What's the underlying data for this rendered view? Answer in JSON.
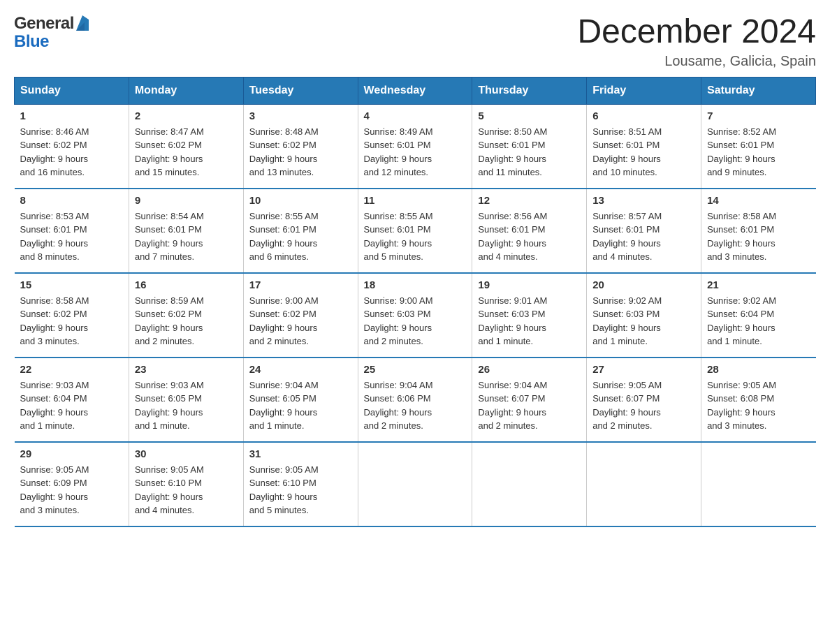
{
  "header": {
    "logo_general": "General",
    "logo_blue": "Blue",
    "month_title": "December 2024",
    "location": "Lousame, Galicia, Spain"
  },
  "days_of_week": [
    "Sunday",
    "Monday",
    "Tuesday",
    "Wednesday",
    "Thursday",
    "Friday",
    "Saturday"
  ],
  "weeks": [
    [
      {
        "day": "1",
        "sunrise": "8:46 AM",
        "sunset": "6:02 PM",
        "daylight": "9 hours and 16 minutes."
      },
      {
        "day": "2",
        "sunrise": "8:47 AM",
        "sunset": "6:02 PM",
        "daylight": "9 hours and 15 minutes."
      },
      {
        "day": "3",
        "sunrise": "8:48 AM",
        "sunset": "6:02 PM",
        "daylight": "9 hours and 13 minutes."
      },
      {
        "day": "4",
        "sunrise": "8:49 AM",
        "sunset": "6:01 PM",
        "daylight": "9 hours and 12 minutes."
      },
      {
        "day": "5",
        "sunrise": "8:50 AM",
        "sunset": "6:01 PM",
        "daylight": "9 hours and 11 minutes."
      },
      {
        "day": "6",
        "sunrise": "8:51 AM",
        "sunset": "6:01 PM",
        "daylight": "9 hours and 10 minutes."
      },
      {
        "day": "7",
        "sunrise": "8:52 AM",
        "sunset": "6:01 PM",
        "daylight": "9 hours and 9 minutes."
      }
    ],
    [
      {
        "day": "8",
        "sunrise": "8:53 AM",
        "sunset": "6:01 PM",
        "daylight": "9 hours and 8 minutes."
      },
      {
        "day": "9",
        "sunrise": "8:54 AM",
        "sunset": "6:01 PM",
        "daylight": "9 hours and 7 minutes."
      },
      {
        "day": "10",
        "sunrise": "8:55 AM",
        "sunset": "6:01 PM",
        "daylight": "9 hours and 6 minutes."
      },
      {
        "day": "11",
        "sunrise": "8:55 AM",
        "sunset": "6:01 PM",
        "daylight": "9 hours and 5 minutes."
      },
      {
        "day": "12",
        "sunrise": "8:56 AM",
        "sunset": "6:01 PM",
        "daylight": "9 hours and 4 minutes."
      },
      {
        "day": "13",
        "sunrise": "8:57 AM",
        "sunset": "6:01 PM",
        "daylight": "9 hours and 4 minutes."
      },
      {
        "day": "14",
        "sunrise": "8:58 AM",
        "sunset": "6:01 PM",
        "daylight": "9 hours and 3 minutes."
      }
    ],
    [
      {
        "day": "15",
        "sunrise": "8:58 AM",
        "sunset": "6:02 PM",
        "daylight": "9 hours and 3 minutes."
      },
      {
        "day": "16",
        "sunrise": "8:59 AM",
        "sunset": "6:02 PM",
        "daylight": "9 hours and 2 minutes."
      },
      {
        "day": "17",
        "sunrise": "9:00 AM",
        "sunset": "6:02 PM",
        "daylight": "9 hours and 2 minutes."
      },
      {
        "day": "18",
        "sunrise": "9:00 AM",
        "sunset": "6:03 PM",
        "daylight": "9 hours and 2 minutes."
      },
      {
        "day": "19",
        "sunrise": "9:01 AM",
        "sunset": "6:03 PM",
        "daylight": "9 hours and 1 minute."
      },
      {
        "day": "20",
        "sunrise": "9:02 AM",
        "sunset": "6:03 PM",
        "daylight": "9 hours and 1 minute."
      },
      {
        "day": "21",
        "sunrise": "9:02 AM",
        "sunset": "6:04 PM",
        "daylight": "9 hours and 1 minute."
      }
    ],
    [
      {
        "day": "22",
        "sunrise": "9:03 AM",
        "sunset": "6:04 PM",
        "daylight": "9 hours and 1 minute."
      },
      {
        "day": "23",
        "sunrise": "9:03 AM",
        "sunset": "6:05 PM",
        "daylight": "9 hours and 1 minute."
      },
      {
        "day": "24",
        "sunrise": "9:04 AM",
        "sunset": "6:05 PM",
        "daylight": "9 hours and 1 minute."
      },
      {
        "day": "25",
        "sunrise": "9:04 AM",
        "sunset": "6:06 PM",
        "daylight": "9 hours and 2 minutes."
      },
      {
        "day": "26",
        "sunrise": "9:04 AM",
        "sunset": "6:07 PM",
        "daylight": "9 hours and 2 minutes."
      },
      {
        "day": "27",
        "sunrise": "9:05 AM",
        "sunset": "6:07 PM",
        "daylight": "9 hours and 2 minutes."
      },
      {
        "day": "28",
        "sunrise": "9:05 AM",
        "sunset": "6:08 PM",
        "daylight": "9 hours and 3 minutes."
      }
    ],
    [
      {
        "day": "29",
        "sunrise": "9:05 AM",
        "sunset": "6:09 PM",
        "daylight": "9 hours and 3 minutes."
      },
      {
        "day": "30",
        "sunrise": "9:05 AM",
        "sunset": "6:10 PM",
        "daylight": "9 hours and 4 minutes."
      },
      {
        "day": "31",
        "sunrise": "9:05 AM",
        "sunset": "6:10 PM",
        "daylight": "9 hours and 5 minutes."
      },
      null,
      null,
      null,
      null
    ]
  ],
  "labels": {
    "sunrise": "Sunrise:",
    "sunset": "Sunset:",
    "daylight": "Daylight:"
  }
}
